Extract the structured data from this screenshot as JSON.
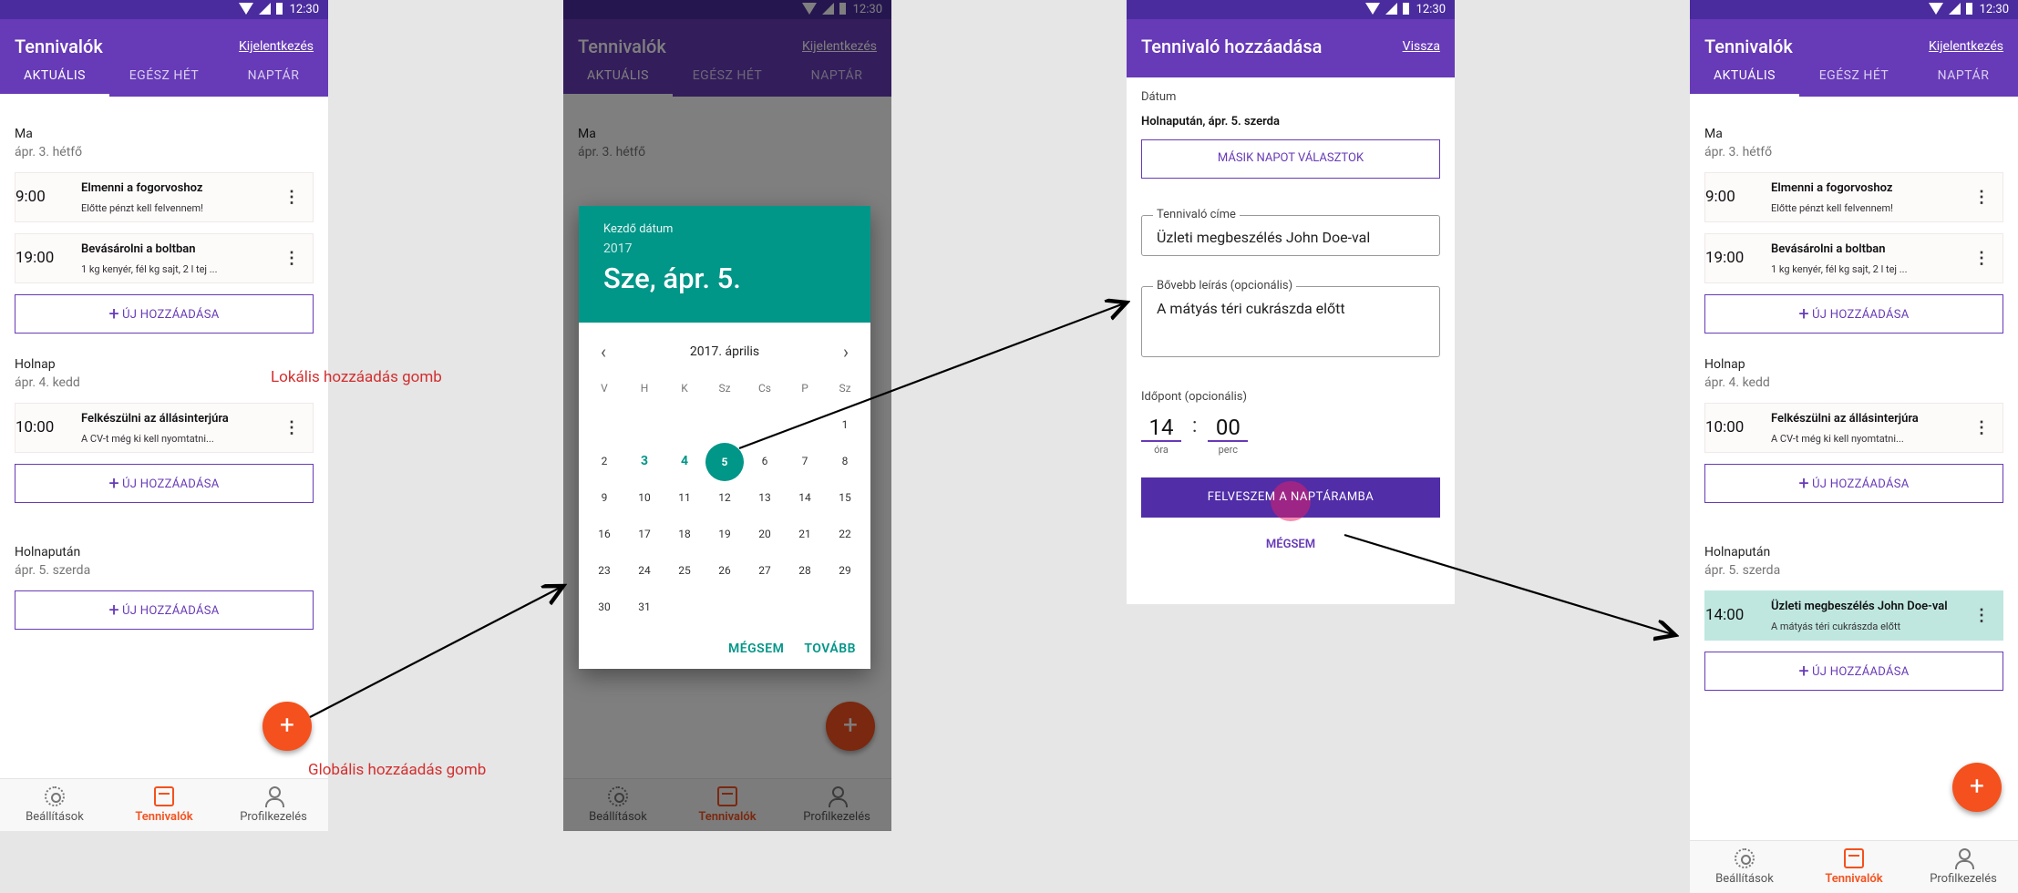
{
  "status": {
    "time": "12:30"
  },
  "screen1": {
    "title": "Tennivalók",
    "logout": "Kijelentkezés",
    "tabs": [
      "AKTUÁLIS",
      "EGÉSZ HÉT",
      "NAPTÁR"
    ],
    "days": [
      {
        "name": "Ma",
        "date": "ápr. 3. hétfő",
        "items": [
          {
            "time": "9:00",
            "title": "Elmenni a fogorvoshoz",
            "desc": "Előtte pénzt kell felvennem!"
          },
          {
            "time": "19:00",
            "title": "Bevásárolni a boltban",
            "desc": "1 kg kenyér, fél kg sajt, 2 l tej ..."
          }
        ]
      },
      {
        "name": "Holnap",
        "date": "ápr. 4. kedd",
        "items": [
          {
            "time": "10:00",
            "title": "Felkészülni az állásinterjúra",
            "desc": "A CV-t még ki kell nyomtatni..."
          }
        ]
      },
      {
        "name": "Holnapután",
        "date": "ápr. 5. szerda",
        "items": []
      }
    ],
    "add_label": "ÚJ HOZZÁADÁSA",
    "fab": "+",
    "nav": [
      "Beállítások",
      "Tennivalók",
      "Profilkezelés"
    ]
  },
  "screen2": {
    "dialog": {
      "label": "Kezdő dátum",
      "year": "2017",
      "date": "Sze, ápr. 5.",
      "month": "2017. április",
      "weekdays": [
        "V",
        "H",
        "K",
        "Sz",
        "Cs",
        "P",
        "Sz"
      ],
      "cancel": "MÉGSEM",
      "next": "TOVÁBB"
    }
  },
  "screen3": {
    "title": "Tennivaló hozzáadása",
    "back": "Vissza",
    "date_label": "Dátum",
    "date_value": "Holnapután, ápr. 5. szerda",
    "other_day": "MÁSIK NAPOT VÁLASZTOK",
    "title_label": "Tennivaló címe",
    "title_value": "Üzleti megbeszélés John Doe-val",
    "desc_label": "Bővebb leírás (opcionális)",
    "desc_value": "A mátyás téri cukrászda előtt",
    "time_label": "Időpont (opcionális)",
    "hour": "14",
    "minute": "00",
    "hour_sub": "óra",
    "minute_sub": "perc",
    "save": "FELVESZEM A NAPTÁRAMBA",
    "cancel": "MÉGSEM"
  },
  "screen4": {
    "new_item": {
      "time": "14:00",
      "title": "Üzleti megbeszélés John Doe-val",
      "desc": "A mátyás téri cukrászda előtt"
    }
  },
  "annotations": {
    "local": "Lokális hozzáadás gomb",
    "global": "Globális hozzáadás gomb"
  },
  "colors": {
    "primary": "#673ab7",
    "accent": "#f4511e",
    "teal": "#009688",
    "annotation": "#d32f2f"
  }
}
